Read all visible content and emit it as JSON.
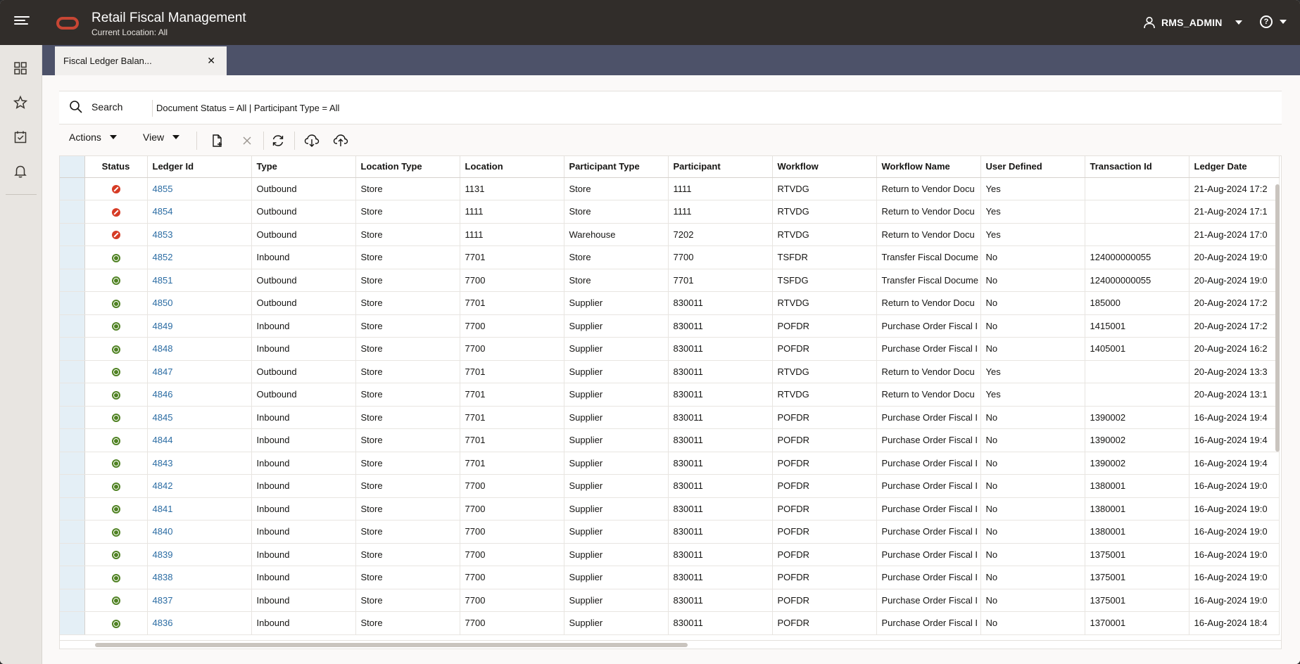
{
  "header": {
    "app_title": "Retail Fiscal Management",
    "location_label": "Current Location: All",
    "user_name": "RMS_ADMIN",
    "help_icon": "?"
  },
  "rail": {
    "items": [
      "dashboard-icon",
      "favorites-star-icon",
      "tasks-icon",
      "notifications-bell-icon"
    ]
  },
  "tabs": [
    {
      "label": "Fiscal Ledger Balan...",
      "close": "✕"
    }
  ],
  "search": {
    "label": "Search",
    "filter_summary": "Document Status = All | Participant Type = All"
  },
  "toolbar": {
    "actions_label": "Actions",
    "view_label": "View",
    "icons": [
      "add-document-icon",
      "delete-icon",
      "refresh-icon",
      "download-icon",
      "upload-icon"
    ]
  },
  "table": {
    "columns": [
      "Status",
      "Ledger Id",
      "Type",
      "Location Type",
      "Location",
      "Participant Type",
      "Participant",
      "Workflow",
      "Workflow Name",
      "User Defined",
      "Transaction Id",
      "Ledger Date"
    ],
    "rows": [
      {
        "status": "error",
        "ledger_id": "4855",
        "type": "Outbound",
        "location_type": "Store",
        "location": "1131",
        "participant_type": "Store",
        "participant": "1111",
        "workflow": "RTVDG",
        "workflow_name": "Return to Vendor Docu",
        "user_defined": "Yes",
        "transaction_id": "",
        "ledger_date": "21-Aug-2024 17:2"
      },
      {
        "status": "error",
        "ledger_id": "4854",
        "type": "Outbound",
        "location_type": "Store",
        "location": "1111",
        "participant_type": "Store",
        "participant": "1111",
        "workflow": "RTVDG",
        "workflow_name": "Return to Vendor Docu",
        "user_defined": "Yes",
        "transaction_id": "",
        "ledger_date": "21-Aug-2024 17:1"
      },
      {
        "status": "error",
        "ledger_id": "4853",
        "type": "Outbound",
        "location_type": "Store",
        "location": "1111",
        "participant_type": "Warehouse",
        "participant": "7202",
        "workflow": "RTVDG",
        "workflow_name": "Return to Vendor Docu",
        "user_defined": "Yes",
        "transaction_id": "",
        "ledger_date": "21-Aug-2024 17:0"
      },
      {
        "status": "success",
        "ledger_id": "4852",
        "type": "Inbound",
        "location_type": "Store",
        "location": "7701",
        "participant_type": "Store",
        "participant": "7700",
        "workflow": "TSFDR",
        "workflow_name": "Transfer Fiscal Docume",
        "user_defined": "No",
        "transaction_id": "124000000055",
        "ledger_date": "20-Aug-2024 19:0"
      },
      {
        "status": "success",
        "ledger_id": "4851",
        "type": "Outbound",
        "location_type": "Store",
        "location": "7700",
        "participant_type": "Store",
        "participant": "7701",
        "workflow": "TSFDG",
        "workflow_name": "Transfer Fiscal Docume",
        "user_defined": "No",
        "transaction_id": "124000000055",
        "ledger_date": "20-Aug-2024 19:0"
      },
      {
        "status": "success",
        "ledger_id": "4850",
        "type": "Outbound",
        "location_type": "Store",
        "location": "7701",
        "participant_type": "Supplier",
        "participant": "830011",
        "workflow": "RTVDG",
        "workflow_name": "Return to Vendor Docu",
        "user_defined": "No",
        "transaction_id": "185000",
        "ledger_date": "20-Aug-2024 17:2"
      },
      {
        "status": "success",
        "ledger_id": "4849",
        "type": "Inbound",
        "location_type": "Store",
        "location": "7700",
        "participant_type": "Supplier",
        "participant": "830011",
        "workflow": "POFDR",
        "workflow_name": "Purchase Order Fiscal I",
        "user_defined": "No",
        "transaction_id": "1415001",
        "ledger_date": "20-Aug-2024 17:2"
      },
      {
        "status": "success",
        "ledger_id": "4848",
        "type": "Inbound",
        "location_type": "Store",
        "location": "7700",
        "participant_type": "Supplier",
        "participant": "830011",
        "workflow": "POFDR",
        "workflow_name": "Purchase Order Fiscal I",
        "user_defined": "No",
        "transaction_id": "1405001",
        "ledger_date": "20-Aug-2024 16:2"
      },
      {
        "status": "success",
        "ledger_id": "4847",
        "type": "Outbound",
        "location_type": "Store",
        "location": "7701",
        "participant_type": "Supplier",
        "participant": "830011",
        "workflow": "RTVDG",
        "workflow_name": "Return to Vendor Docu",
        "user_defined": "Yes",
        "transaction_id": "",
        "ledger_date": "20-Aug-2024 13:3"
      },
      {
        "status": "success",
        "ledger_id": "4846",
        "type": "Outbound",
        "location_type": "Store",
        "location": "7701",
        "participant_type": "Supplier",
        "participant": "830011",
        "workflow": "RTVDG",
        "workflow_name": "Return to Vendor Docu",
        "user_defined": "Yes",
        "transaction_id": "",
        "ledger_date": "20-Aug-2024 13:1"
      },
      {
        "status": "success",
        "ledger_id": "4845",
        "type": "Inbound",
        "location_type": "Store",
        "location": "7701",
        "participant_type": "Supplier",
        "participant": "830011",
        "workflow": "POFDR",
        "workflow_name": "Purchase Order Fiscal I",
        "user_defined": "No",
        "transaction_id": "1390002",
        "ledger_date": "16-Aug-2024 19:4"
      },
      {
        "status": "success",
        "ledger_id": "4844",
        "type": "Inbound",
        "location_type": "Store",
        "location": "7701",
        "participant_type": "Supplier",
        "participant": "830011",
        "workflow": "POFDR",
        "workflow_name": "Purchase Order Fiscal I",
        "user_defined": "No",
        "transaction_id": "1390002",
        "ledger_date": "16-Aug-2024 19:4"
      },
      {
        "status": "success",
        "ledger_id": "4843",
        "type": "Inbound",
        "location_type": "Store",
        "location": "7701",
        "participant_type": "Supplier",
        "participant": "830011",
        "workflow": "POFDR",
        "workflow_name": "Purchase Order Fiscal I",
        "user_defined": "No",
        "transaction_id": "1390002",
        "ledger_date": "16-Aug-2024 19:4"
      },
      {
        "status": "success",
        "ledger_id": "4842",
        "type": "Inbound",
        "location_type": "Store",
        "location": "7700",
        "participant_type": "Supplier",
        "participant": "830011",
        "workflow": "POFDR",
        "workflow_name": "Purchase Order Fiscal I",
        "user_defined": "No",
        "transaction_id": "1380001",
        "ledger_date": "16-Aug-2024 19:0"
      },
      {
        "status": "success",
        "ledger_id": "4841",
        "type": "Inbound",
        "location_type": "Store",
        "location": "7700",
        "participant_type": "Supplier",
        "participant": "830011",
        "workflow": "POFDR",
        "workflow_name": "Purchase Order Fiscal I",
        "user_defined": "No",
        "transaction_id": "1380001",
        "ledger_date": "16-Aug-2024 19:0"
      },
      {
        "status": "success",
        "ledger_id": "4840",
        "type": "Inbound",
        "location_type": "Store",
        "location": "7700",
        "participant_type": "Supplier",
        "participant": "830011",
        "workflow": "POFDR",
        "workflow_name": "Purchase Order Fiscal I",
        "user_defined": "No",
        "transaction_id": "1380001",
        "ledger_date": "16-Aug-2024 19:0"
      },
      {
        "status": "success",
        "ledger_id": "4839",
        "type": "Inbound",
        "location_type": "Store",
        "location": "7700",
        "participant_type": "Supplier",
        "participant": "830011",
        "workflow": "POFDR",
        "workflow_name": "Purchase Order Fiscal I",
        "user_defined": "No",
        "transaction_id": "1375001",
        "ledger_date": "16-Aug-2024 19:0"
      },
      {
        "status": "success",
        "ledger_id": "4838",
        "type": "Inbound",
        "location_type": "Store",
        "location": "7700",
        "participant_type": "Supplier",
        "participant": "830011",
        "workflow": "POFDR",
        "workflow_name": "Purchase Order Fiscal I",
        "user_defined": "No",
        "transaction_id": "1375001",
        "ledger_date": "16-Aug-2024 19:0"
      },
      {
        "status": "success",
        "ledger_id": "4837",
        "type": "Inbound",
        "location_type": "Store",
        "location": "7700",
        "participant_type": "Supplier",
        "participant": "830011",
        "workflow": "POFDR",
        "workflow_name": "Purchase Order Fiscal I",
        "user_defined": "No",
        "transaction_id": "1375001",
        "ledger_date": "16-Aug-2024 19:0"
      },
      {
        "status": "success",
        "ledger_id": "4836",
        "type": "Inbound",
        "location_type": "Store",
        "location": "7700",
        "participant_type": "Supplier",
        "participant": "830011",
        "workflow": "POFDR",
        "workflow_name": "Purchase Order Fiscal I",
        "user_defined": "No",
        "transaction_id": "1370001",
        "ledger_date": "16-Aug-2024 18:4"
      }
    ]
  },
  "colors": {
    "header_bg": "#312d2a",
    "tabstrip_bg": "#4d5269",
    "brand_red": "#c74634",
    "link": "#2b6ca3",
    "status_error": "#d63b25",
    "status_success": "#508223"
  }
}
